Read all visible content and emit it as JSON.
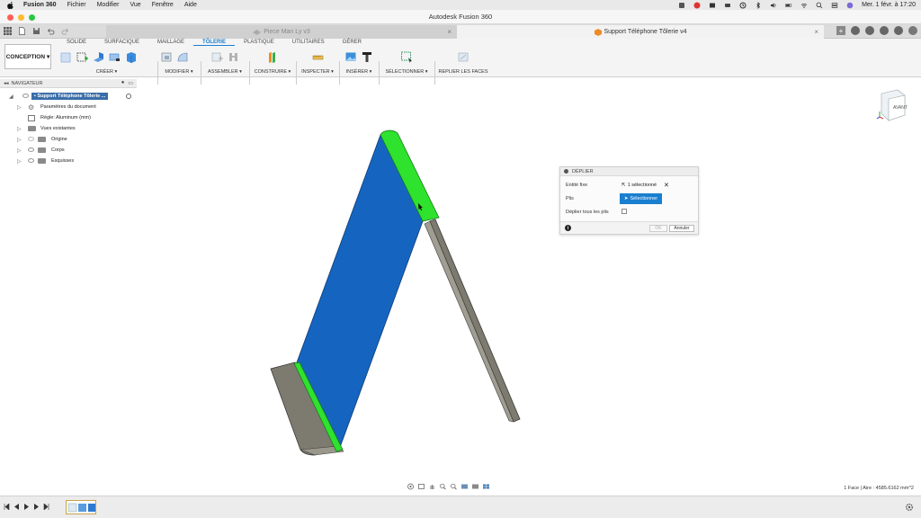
{
  "menubar": {
    "app": "Fusion 360",
    "items": [
      "Fichier",
      "Modifier",
      "Vue",
      "Fenêtre",
      "Aide"
    ],
    "clock": "Mer. 1 févr. à 17:20"
  },
  "window": {
    "title": "Autodesk Fusion 360"
  },
  "doc_tabs": [
    {
      "label": "Piece Man Ly v3",
      "active": false
    },
    {
      "label": "Support Téléphone Tôlerie v4",
      "active": true
    }
  ],
  "ribbon": {
    "workspace": "CONCEPTION",
    "tabs": [
      "SOLIDE",
      "SURFACIQUE",
      "MAILLAGE",
      "TÔLERIE",
      "PLASTIQUE",
      "UTILITAIRES",
      "GÉRER"
    ],
    "active_tab": "TÔLERIE",
    "groups": {
      "creer": "CRÉER",
      "modifier": "MODIFIER",
      "assembler": "ASSEMBLER",
      "construire": "CONSTRUIRE",
      "inspecter": "INSPECTER",
      "inserer": "INSÉRER",
      "selectionner": "SÉLECTIONNER",
      "replier": "REPLIER LES FACES"
    }
  },
  "navigator": {
    "title": "NAVIGATEUR",
    "root": "Support Téléphone Tôlerie ...",
    "items": [
      "Paramètres du document",
      "Règle: Aluminum (mm)",
      "Vues existantes",
      "Origine",
      "Corps",
      "Esquisses"
    ]
  },
  "dialog": {
    "title": "DÉPLIER",
    "entite_label": "Entité fixe",
    "entite_value": "1 sélectionné",
    "plis_label": "Plis",
    "plis_button": "Sélectionner",
    "deplier_label": "Déplier tous les plis",
    "ok": "OK",
    "cancel": "Annuler"
  },
  "status": "1 Face | Aire : 4585.6162 mm^2",
  "colors": {
    "accent": "#1a7fd1",
    "face_blue": "#1565c0",
    "bend_green": "#2ee22e",
    "metal_gray": "#7d7a70"
  }
}
